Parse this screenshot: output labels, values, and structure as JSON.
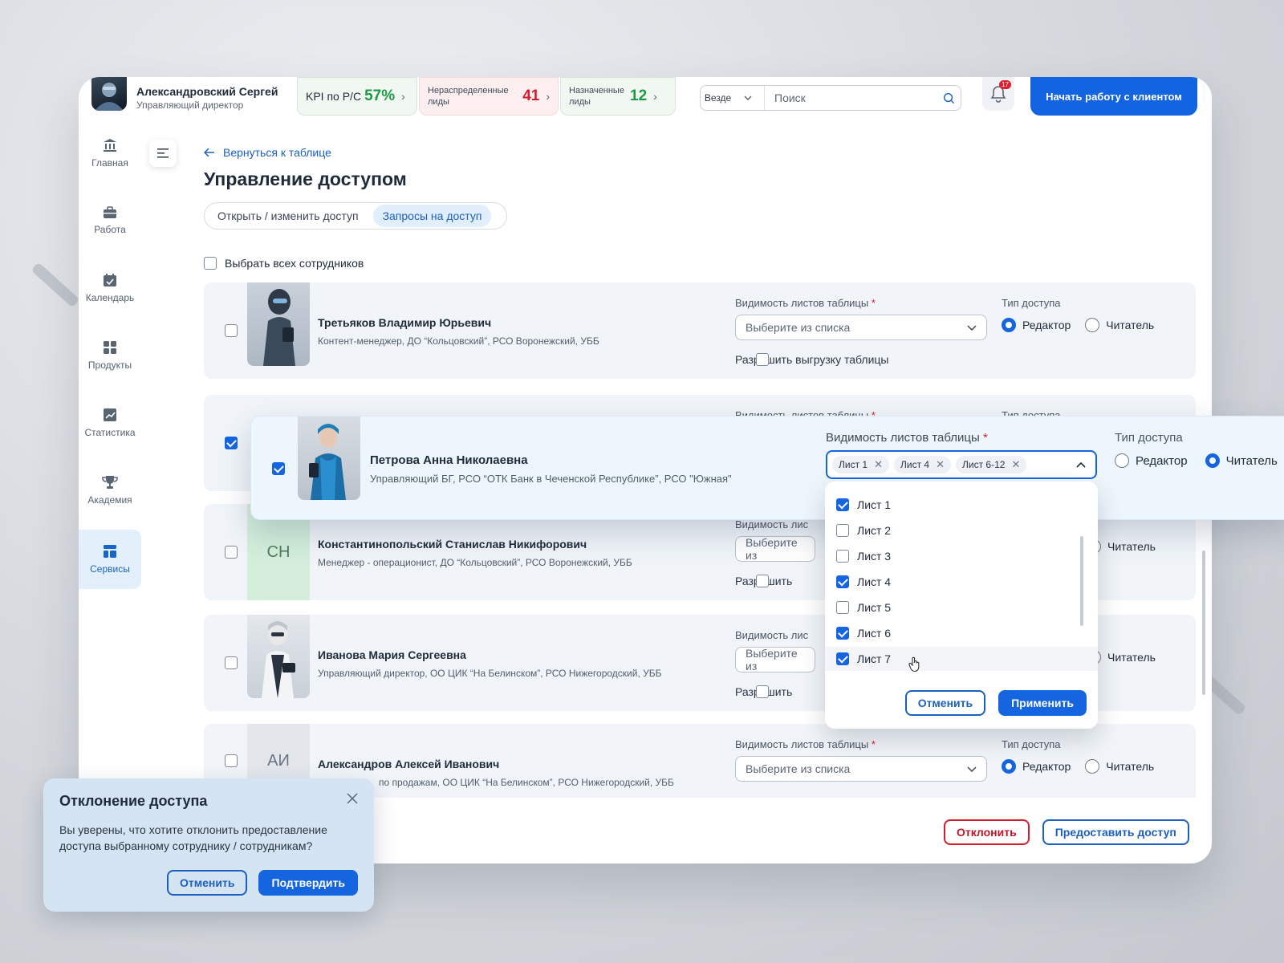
{
  "header": {
    "user_name": "Александровский Сергей",
    "user_role": "Управляющий директор",
    "kpi": {
      "label": "KPI по Р/С",
      "value": "57%"
    },
    "unassigned": {
      "label": "Нераспределенные лиды",
      "value": "41"
    },
    "assigned": {
      "label": "Назначенные лиды",
      "value": "12"
    },
    "search_scope": "Везде",
    "search_placeholder": "Поиск",
    "notifications_count": "17",
    "start_button": "Начать работу с клиентом"
  },
  "sidebar": {
    "items": [
      {
        "label": "Главная",
        "icon": "bank-icon"
      },
      {
        "label": "Работа",
        "icon": "briefcase-icon"
      },
      {
        "label": "Календарь",
        "icon": "calendar-icon"
      },
      {
        "label": "Продукты",
        "icon": "grid-icon"
      },
      {
        "label": "Статистика",
        "icon": "chart-icon"
      },
      {
        "label": "Академия",
        "icon": "trophy-icon"
      },
      {
        "label": "Сервисы",
        "icon": "services-icon",
        "active": true
      }
    ]
  },
  "content": {
    "back_link": "Вернуться к таблице",
    "title": "Управление доступом",
    "tabs": [
      "Открыть / изменить доступ",
      "Запросы на доступ"
    ],
    "active_tab": 1,
    "select_all": "Выбрать всех сотрудников",
    "labels": {
      "visibility": "Видимость листов таблицы",
      "required": "*",
      "access_type": "Тип доступа",
      "select_placeholder": "Выберите из списка",
      "allow_export": "Разрешить выгрузку таблицы",
      "allow_export_short": "Разрешить",
      "editor": "Редактор",
      "reader": "Читатель",
      "visibility_short": "Видимость лис",
      "select_short": "Выберите из"
    },
    "employees": [
      {
        "name": "Третьяков Владимир Юрьевич",
        "role": "Контент-менеджер, ДО “Кольцовский”, РСО Воронежский, УББ",
        "checked": false,
        "access": "editor"
      },
      {
        "name": "Петрова Анна Николаевна",
        "role": "Управляющий БГ, РСО “ОТК Банк в Чеченской Республике”, РСО \"Южная\"",
        "checked": true,
        "access": "reader"
      },
      {
        "name": "Константинопольский Станислав Никифорович",
        "role": "Менеджер - операционист, ДО “Кольцовский”, РСО Воронежский, УББ",
        "initials": "СН",
        "checked": false,
        "access": "reader"
      },
      {
        "name": "Иванова Мария Сергеевна",
        "role": "Управляющий директор, ОО ЦИК “На Белинском”, РСО Нижегородский, УББ",
        "checked": false,
        "access": "reader"
      },
      {
        "name": "Александров Алексей Иванович",
        "role": "по продажам, ОО ЦИК “На Белинском”, РСО Нижегородский, УББ",
        "initials": "АИ",
        "checked": false,
        "access": "editor"
      }
    ],
    "chips": [
      "Лист 1",
      "Лист 4",
      "Лист 6-12"
    ],
    "sheet_options": [
      {
        "label": "Лист 1",
        "checked": true
      },
      {
        "label": "Лист 2",
        "checked": false
      },
      {
        "label": "Лист 3",
        "checked": false
      },
      {
        "label": "Лист 4",
        "checked": true
      },
      {
        "label": "Лист 5",
        "checked": false
      },
      {
        "label": "Лист 6",
        "checked": true
      },
      {
        "label": "Лист 7",
        "checked": true
      }
    ],
    "dropdown_cancel": "Отменить",
    "dropdown_apply": "Применить",
    "reject_button": "Отклонить",
    "grant_button": "Предоставить доступ"
  },
  "modal": {
    "title": "Отклонение доступа",
    "text": "Вы уверены, что хотите отклонить предоставление доступа выбранному сотруднику / сотрудникам?",
    "cancel": "Отменить",
    "confirm": "Подтвердить"
  },
  "colors": {
    "primary": "#1565e0",
    "danger": "#d51c2e",
    "success": "#1e9a46"
  }
}
